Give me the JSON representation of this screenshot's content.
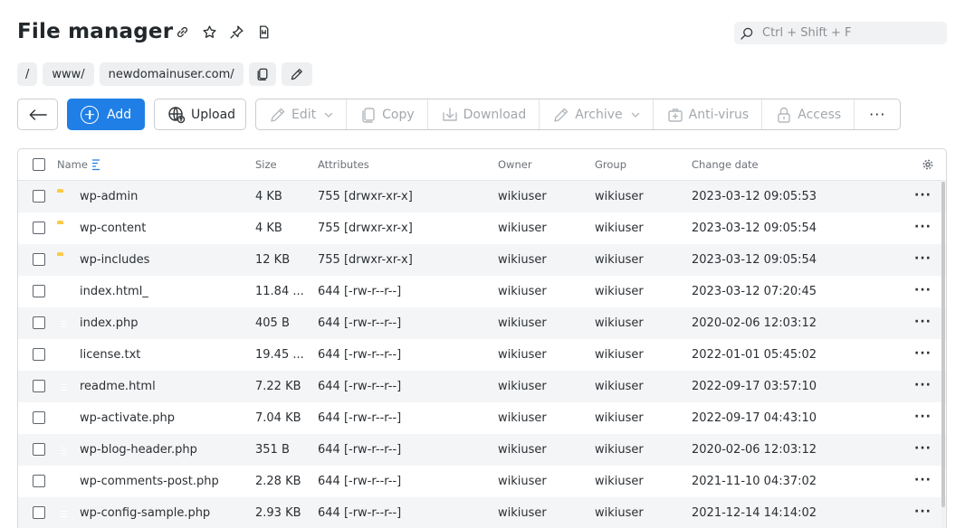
{
  "header": {
    "title": "File manager",
    "icons": [
      "link-icon",
      "star-icon",
      "pin-icon",
      "bookmark-icon"
    ]
  },
  "search": {
    "placeholder": "Ctrl + Shift + F"
  },
  "breadcrumb": {
    "items": [
      "/",
      "www/",
      "newdomainuser.com/"
    ],
    "actions": [
      "copy-path-icon",
      "edit-path-icon"
    ]
  },
  "toolbar": {
    "add_label": "Add",
    "upload_label": "Upload",
    "edit_label": "Edit",
    "copy_label": "Copy",
    "download_label": "Download",
    "archive_label": "Archive",
    "antivirus_label": "Anti-virus",
    "access_label": "Access",
    "more_label": "···"
  },
  "table": {
    "columns": {
      "name": "Name",
      "size": "Size",
      "attributes": "Attributes",
      "owner": "Owner",
      "group": "Group",
      "date": "Change date"
    },
    "rows": [
      {
        "type": "folder",
        "name": "wp-admin",
        "size": "4 KB",
        "attributes": "755 [drwxr-xr-x]",
        "owner": "wikiuser",
        "group": "wikiuser",
        "date": "2023-03-12 09:05:53"
      },
      {
        "type": "folder",
        "name": "wp-content",
        "size": "4 KB",
        "attributes": "755 [drwxr-xr-x]",
        "owner": "wikiuser",
        "group": "wikiuser",
        "date": "2023-03-12 09:05:54"
      },
      {
        "type": "folder",
        "name": "wp-includes",
        "size": "12 KB",
        "attributes": "755 [drwxr-xr-x]",
        "owner": "wikiuser",
        "group": "wikiuser",
        "date": "2023-03-12 09:05:54"
      },
      {
        "type": "file",
        "name": "index.html_",
        "size": "11.84 ...",
        "attributes": "644 [-rw-r--r--]",
        "owner": "wikiuser",
        "group": "wikiuser",
        "date": "2023-03-12 07:20:45"
      },
      {
        "type": "file",
        "name": "index.php",
        "size": "405 B",
        "attributes": "644 [-rw-r--r--]",
        "owner": "wikiuser",
        "group": "wikiuser",
        "date": "2020-02-06 12:03:12"
      },
      {
        "type": "file",
        "name": "license.txt",
        "size": "19.45 ...",
        "attributes": "644 [-rw-r--r--]",
        "owner": "wikiuser",
        "group": "wikiuser",
        "date": "2022-01-01 05:45:02"
      },
      {
        "type": "file",
        "name": "readme.html",
        "size": "7.22 KB",
        "attributes": "644 [-rw-r--r--]",
        "owner": "wikiuser",
        "group": "wikiuser",
        "date": "2022-09-17 03:57:10"
      },
      {
        "type": "file",
        "name": "wp-activate.php",
        "size": "7.04 KB",
        "attributes": "644 [-rw-r--r--]",
        "owner": "wikiuser",
        "group": "wikiuser",
        "date": "2022-09-17 04:43:10"
      },
      {
        "type": "file",
        "name": "wp-blog-header.php",
        "size": "351 B",
        "attributes": "644 [-rw-r--r--]",
        "owner": "wikiuser",
        "group": "wikiuser",
        "date": "2020-02-06 12:03:12"
      },
      {
        "type": "file",
        "name": "wp-comments-post.php",
        "size": "2.28 KB",
        "attributes": "644 [-rw-r--r--]",
        "owner": "wikiuser",
        "group": "wikiuser",
        "date": "2021-11-10 04:37:02"
      },
      {
        "type": "file",
        "name": "wp-config-sample.php",
        "size": "2.93 KB",
        "attributes": "644 [-rw-r--r--]",
        "owner": "wikiuser",
        "group": "wikiuser",
        "date": "2021-12-14 14:14:02"
      }
    ],
    "row_action": "···"
  },
  "colors": {
    "accent": "#1f7fe6",
    "folder": "#ffc84a",
    "file": "#2175d9"
  }
}
